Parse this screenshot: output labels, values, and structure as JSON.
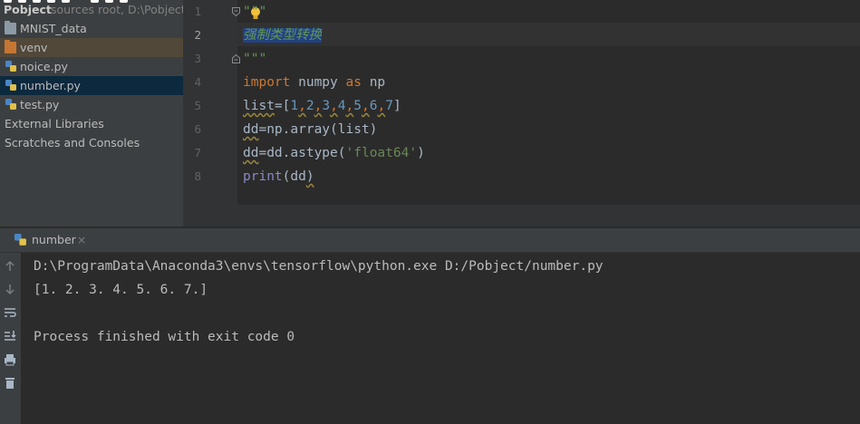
{
  "project": {
    "root_name": "Pobject",
    "root_hint": "sources root, D:\\Pobject",
    "items": [
      {
        "label": "MNIST_data",
        "icon": "folder-icon"
      },
      {
        "label": "venv",
        "icon": "folder-icon"
      },
      {
        "label": "noice.py",
        "icon": "python-file-icon"
      },
      {
        "label": "number.py",
        "icon": "python-file-icon"
      },
      {
        "label": "test.py",
        "icon": "python-file-icon"
      },
      {
        "label": "External Libraries",
        "icon": ""
      },
      {
        "label": "Scratches and Consoles",
        "icon": ""
      }
    ],
    "selected_item": "number.py"
  },
  "editor": {
    "current_line": 2,
    "line_numbers": [
      "1",
      "2",
      "3",
      "4",
      "5",
      "6",
      "7",
      "8"
    ],
    "lines": {
      "l1": "\"\"\"",
      "l2": "强制类型转换",
      "l3": "\"\"\"",
      "l4_kw1": "import",
      "l4_mid": " numpy ",
      "l4_kw2": "as",
      "l4_end": " np",
      "l5_a": "list",
      "l5_b": "=[",
      "l5_n1": "1",
      "l5_n2": "2",
      "l5_n3": "3",
      "l5_n4": "4",
      "l5_n5": "5",
      "l5_n6": "6",
      "l5_n7": "7",
      "l5_close": "]",
      "l6_a": "dd",
      "l6_b": "=np.array(list)",
      "l7_a": "dd",
      "l7_b": "=dd.astype(",
      "l7_str": "'float64'",
      "l7_c": ")",
      "l8_a": "print",
      "l8_b": "(dd",
      "l8_c": ")"
    }
  },
  "run": {
    "tab_label": "number",
    "tab_close": "×",
    "output": [
      "D:\\ProgramData\\Anaconda3\\envs\\tensorflow\\python.exe D:/Pobject/number.py",
      "[1. 2. 3. 4. 5. 6. 7.]",
      "",
      "Process finished with exit code 0"
    ]
  },
  "colors": {
    "background": "#2b2b2b",
    "panel": "#3c3f41",
    "selection": "#0d293e",
    "keyword": "#cc7832",
    "string": "#6a8759",
    "number": "#6897bb",
    "docstring": "#629755"
  }
}
